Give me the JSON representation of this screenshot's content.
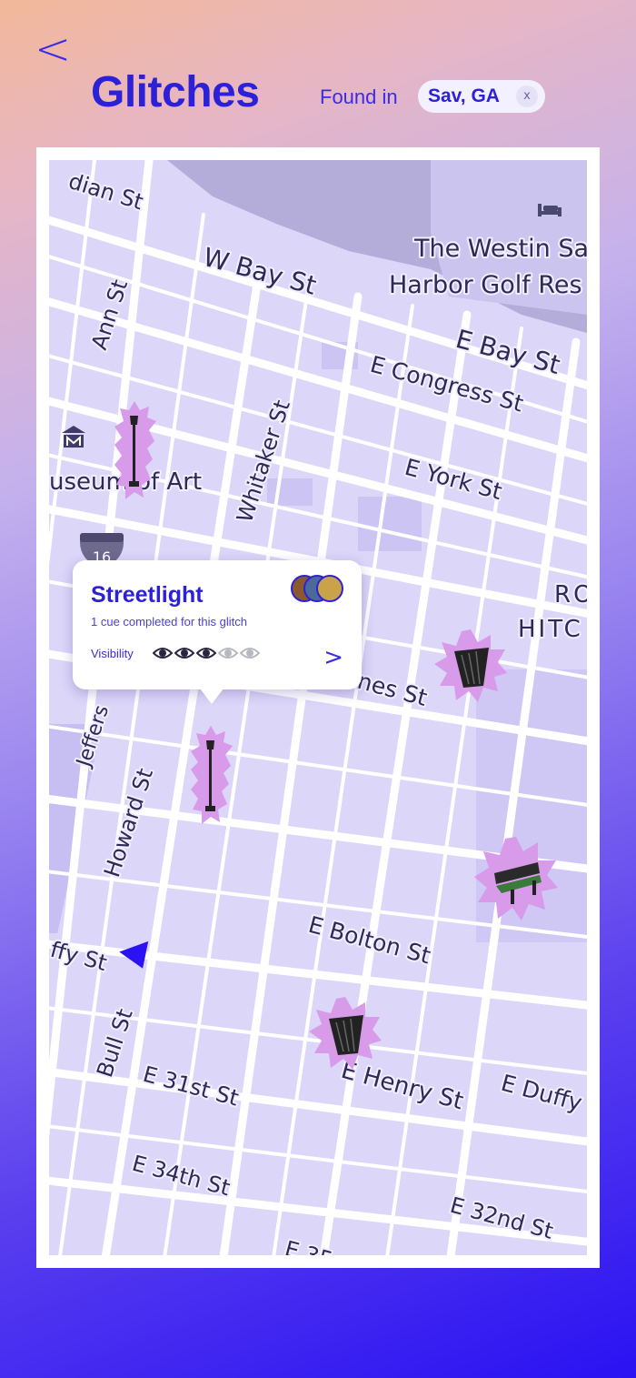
{
  "header": {
    "back_icon": "chevron-left-icon",
    "title": "Glitches",
    "found_label": "Found in",
    "location_chip": "Sav, GA",
    "clear_label": "x"
  },
  "map": {
    "streets": {
      "indian": "dian St",
      "w_bay": "W Bay St",
      "ann": "Ann St",
      "e_bay": "E Bay St",
      "e_congress": "E Congress St",
      "whitaker": "Whitaker St",
      "e_york": "E York St",
      "museum": "useum of Art",
      "westin_1": "The Westin Sa",
      "westin_2": "Harbor Golf Res",
      "jefferson": "Jeffers",
      "howard": "Howard St",
      "oglethorpe": "nes St",
      "duffy_w": "ffy St",
      "bull": "Bull St",
      "e_bolton": "E Bolton St",
      "e_31st": "E 31st St",
      "e_henry": "E Henry St",
      "e_duffy": "E Duffy",
      "e_34th": "E 34th St",
      "e_32nd": "E 32nd St",
      "e_35": "E 35",
      "ro": "RO",
      "hitc": "HITC",
      "interstate": "16"
    },
    "icons": [
      "hotel-icon",
      "museum-icon",
      "interstate-shield-icon",
      "location-arrow-icon"
    ]
  },
  "popup": {
    "title": "Streetlight",
    "subtitle": "1 cue completed for this glitch",
    "visibility_label": "Visibility",
    "visibility_level": 3,
    "visibility_max": 5,
    "next_label": ">",
    "avatar_count": 3
  },
  "markers": [
    {
      "type": "streetlight",
      "icon": "streetlight-icon"
    },
    {
      "type": "streetlight",
      "icon": "streetlight-icon"
    },
    {
      "type": "trash-can",
      "icon": "trash-can-icon"
    },
    {
      "type": "bench",
      "icon": "bench-icon"
    },
    {
      "type": "trash-can",
      "icon": "trash-can-icon"
    }
  ],
  "colors": {
    "accent": "#2d21d8",
    "map_bg": "#dcd6f9",
    "road": "#ffffff",
    "water": "#b4acd9",
    "marker_burst": "#d89bea",
    "eye_filled": "#2a2540",
    "eye_empty": "#b8b8c0"
  }
}
